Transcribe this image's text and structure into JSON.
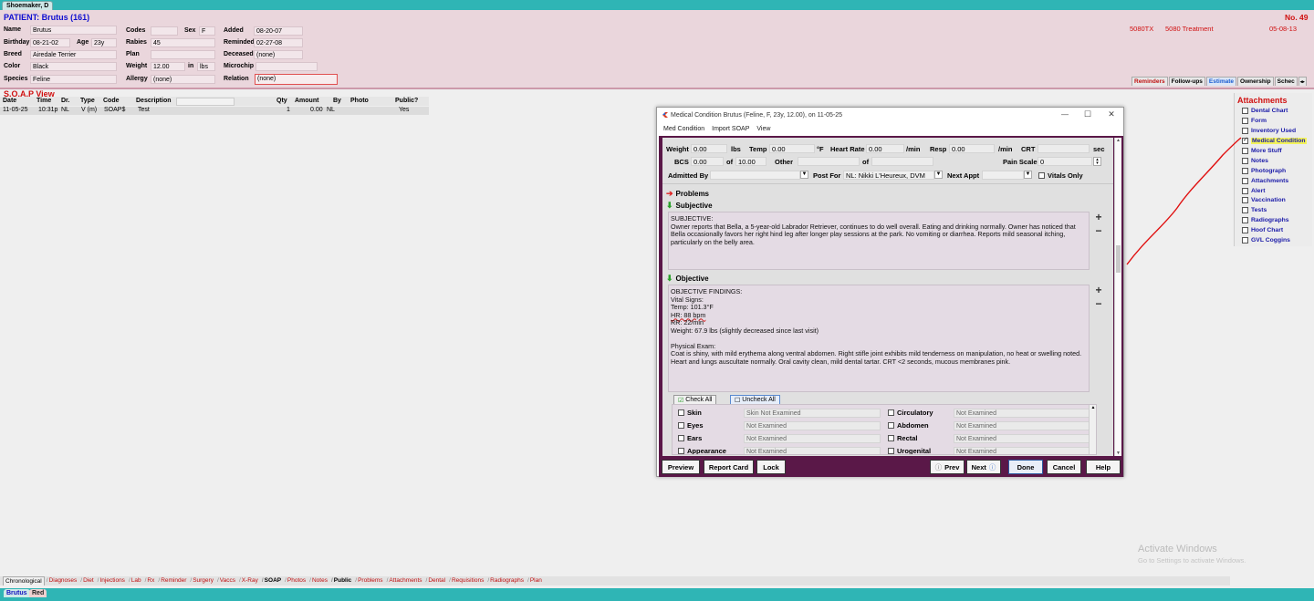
{
  "top_tab": "Shoemaker, D",
  "patient": {
    "title": "PATIENT:  Brutus (161)",
    "name_label": "Name",
    "name": "Brutus",
    "birthday_label": "Birthday",
    "birthday": "08-21-02",
    "age_label": "Age",
    "age": "23y",
    "breed_label": "Breed",
    "breed": "Airedale Terrier",
    "color_label": "Color",
    "color": "Black",
    "species_label": "Species",
    "species": "Feline",
    "codes_label": "Codes",
    "codes": "",
    "sex_label": "Sex",
    "sex": "F",
    "rabies_label": "Rabies",
    "rabies": "45",
    "plan_label": "Plan",
    "plan": "",
    "weight_label": "Weight",
    "weight": "12.00",
    "weight_in": "in",
    "weight_unit": "lbs",
    "allergy_label": "Allergy",
    "allergy": "(none)",
    "added_label": "Added",
    "added": "08-20-07",
    "reminded_label": "Reminded",
    "reminded": "02-27-08",
    "deceased_label": "Deceased",
    "deceased": "(none)",
    "microchip_label": "Microchip",
    "microchip": "",
    "relation_label": "Relation",
    "relation": "(none)",
    "number": "No. 49",
    "code_5080": "5080TX",
    "treatment": "5080 Treatment",
    "treatment_date": "05-08-13"
  },
  "right_tabs": [
    "Reminders",
    "Follow-ups",
    "Estimate",
    "Ownership",
    "Schec"
  ],
  "soap": {
    "title": "S.O.A.P View",
    "columns": [
      "Date",
      "Time",
      "Dr.",
      "Type",
      "Code",
      "Description",
      "Qty",
      "Amount",
      "By",
      "Photo",
      "Public?"
    ],
    "row": {
      "date": "11-05-25",
      "time": "10:31p",
      "dr": "NL",
      "type": "V (m)",
      "code": "SOAP$",
      "description": "Test",
      "qty": "1",
      "amount": "0.00",
      "by": "NL",
      "photo": "",
      "public": "Yes"
    }
  },
  "attachments": {
    "title": "Attachments",
    "items": [
      {
        "label": "Dental Chart",
        "checked": false
      },
      {
        "label": "Form",
        "checked": false
      },
      {
        "label": "Inventory Used",
        "checked": false
      },
      {
        "label": "Medical Condition",
        "checked": true
      },
      {
        "label": "More Stuff",
        "checked": false
      },
      {
        "label": "Notes",
        "checked": false
      },
      {
        "label": "Photograph",
        "checked": false
      },
      {
        "label": "Attachments",
        "checked": false
      },
      {
        "label": "Alert",
        "checked": false
      },
      {
        "label": "Vaccination",
        "checked": false
      },
      {
        "label": "Tests",
        "checked": false
      },
      {
        "label": "Radiographs",
        "checked": false
      },
      {
        "label": "Hoof Chart",
        "checked": false
      },
      {
        "label": "GVL Coggins",
        "checked": false
      }
    ]
  },
  "dialog": {
    "title": "Medical Condition  Brutus (Feline, F, 23y, 12.00), on 11-05-25",
    "menu": [
      "Med Condition",
      "Import SOAP",
      "View"
    ],
    "vitals": {
      "weight_label": "Weight",
      "weight": "0.00",
      "weight_unit": "lbs",
      "temp_label": "Temp",
      "temp": "0.00",
      "temp_unit": "°F",
      "hr_label": "Heart Rate",
      "hr": "0.00",
      "hr_unit": "/min",
      "resp_label": "Resp",
      "resp": "0.00",
      "resp_unit": "/min",
      "crt_label": "CRT",
      "crt": "",
      "crt_unit": "sec",
      "bcs_label": "BCS",
      "bcs": "0.00",
      "bcs_of": "of",
      "bcs_max": "10.00",
      "other_label": "Other",
      "other": "",
      "other_of": "of",
      "other_max": "",
      "pain_label": "Pain Scale",
      "pain": "0",
      "admitted_label": "Admitted By",
      "admitted": "",
      "postfor_label": "Post For",
      "postfor": "NL: Nikki L'Heureux, DVM",
      "nextappt_label": "Next Appt",
      "nextappt": "",
      "vitals_only_label": "Vitals Only"
    },
    "problems_label": "Problems",
    "subjective_label": "Subjective",
    "subjective_text": "SUBJECTIVE:\nOwner reports that Bella, a 5-year-old Labrador Retriever, continues to do well overall. Eating and drinking normally. Owner has noticed that Bella occasionally favors her right hind leg after longer play sessions at the park. No vomiting or diarrhea. Reports mild seasonal itching, particularly on the belly area.",
    "objective_label": "Objective",
    "objective_lines": [
      "OBJECTIVE FINDINGS:",
      "Vital Signs:",
      "Temp: 101.3°F",
      "HR: 88 bpm",
      "RR: 22/min",
      "Weight: 67.9 lbs (slightly decreased since last visit)",
      "",
      "Physical Exam:",
      "Coat is shiny, with mild erythema along ventral abdomen. Right stifle joint exhibits mild tenderness on manipulation, no heat or swelling noted. Heart and lungs auscultate normally. Oral cavity clean, mild dental tartar. CRT <2 seconds, mucous membranes pink."
    ],
    "check_all": "Check All",
    "uncheck_all": "Uncheck All",
    "exam_left": [
      {
        "label": "Skin",
        "value": "Skin Not Examined"
      },
      {
        "label": "Eyes",
        "value": "Not Examined"
      },
      {
        "label": "Ears",
        "value": "Not Examined"
      },
      {
        "label": "Appearance",
        "value": "Not Examined"
      }
    ],
    "exam_right": [
      {
        "label": "Circulatory",
        "value": "Not Examined"
      },
      {
        "label": "Abdomen",
        "value": "Not Examined"
      },
      {
        "label": "Rectal",
        "value": "Not Examined"
      },
      {
        "label": "Urogenital",
        "value": "Not Examined"
      }
    ],
    "buttons": {
      "preview": "Preview",
      "report_card": "Report Card",
      "lock": "Lock",
      "prev": "Prev",
      "next": "Next",
      "done": "Done",
      "cancel": "Cancel",
      "help": "Help"
    }
  },
  "bottom_tabs": [
    "Chronological",
    "Diagnoses",
    "Diet",
    "Injections",
    "Lab",
    "Rx",
    "Reminder",
    "Surgery",
    "Vaccs",
    "X-Ray",
    "SOAP",
    "Photos",
    "Notes",
    "Public",
    "Problems",
    "Attachments",
    "Dental",
    "Requisitions",
    "Radiographs",
    "Plan"
  ],
  "footer_tabs": [
    "Brutus",
    "Red"
  ],
  "watermark": {
    "line1": "Activate Windows",
    "line2": "Go to Settings to activate Windows."
  }
}
